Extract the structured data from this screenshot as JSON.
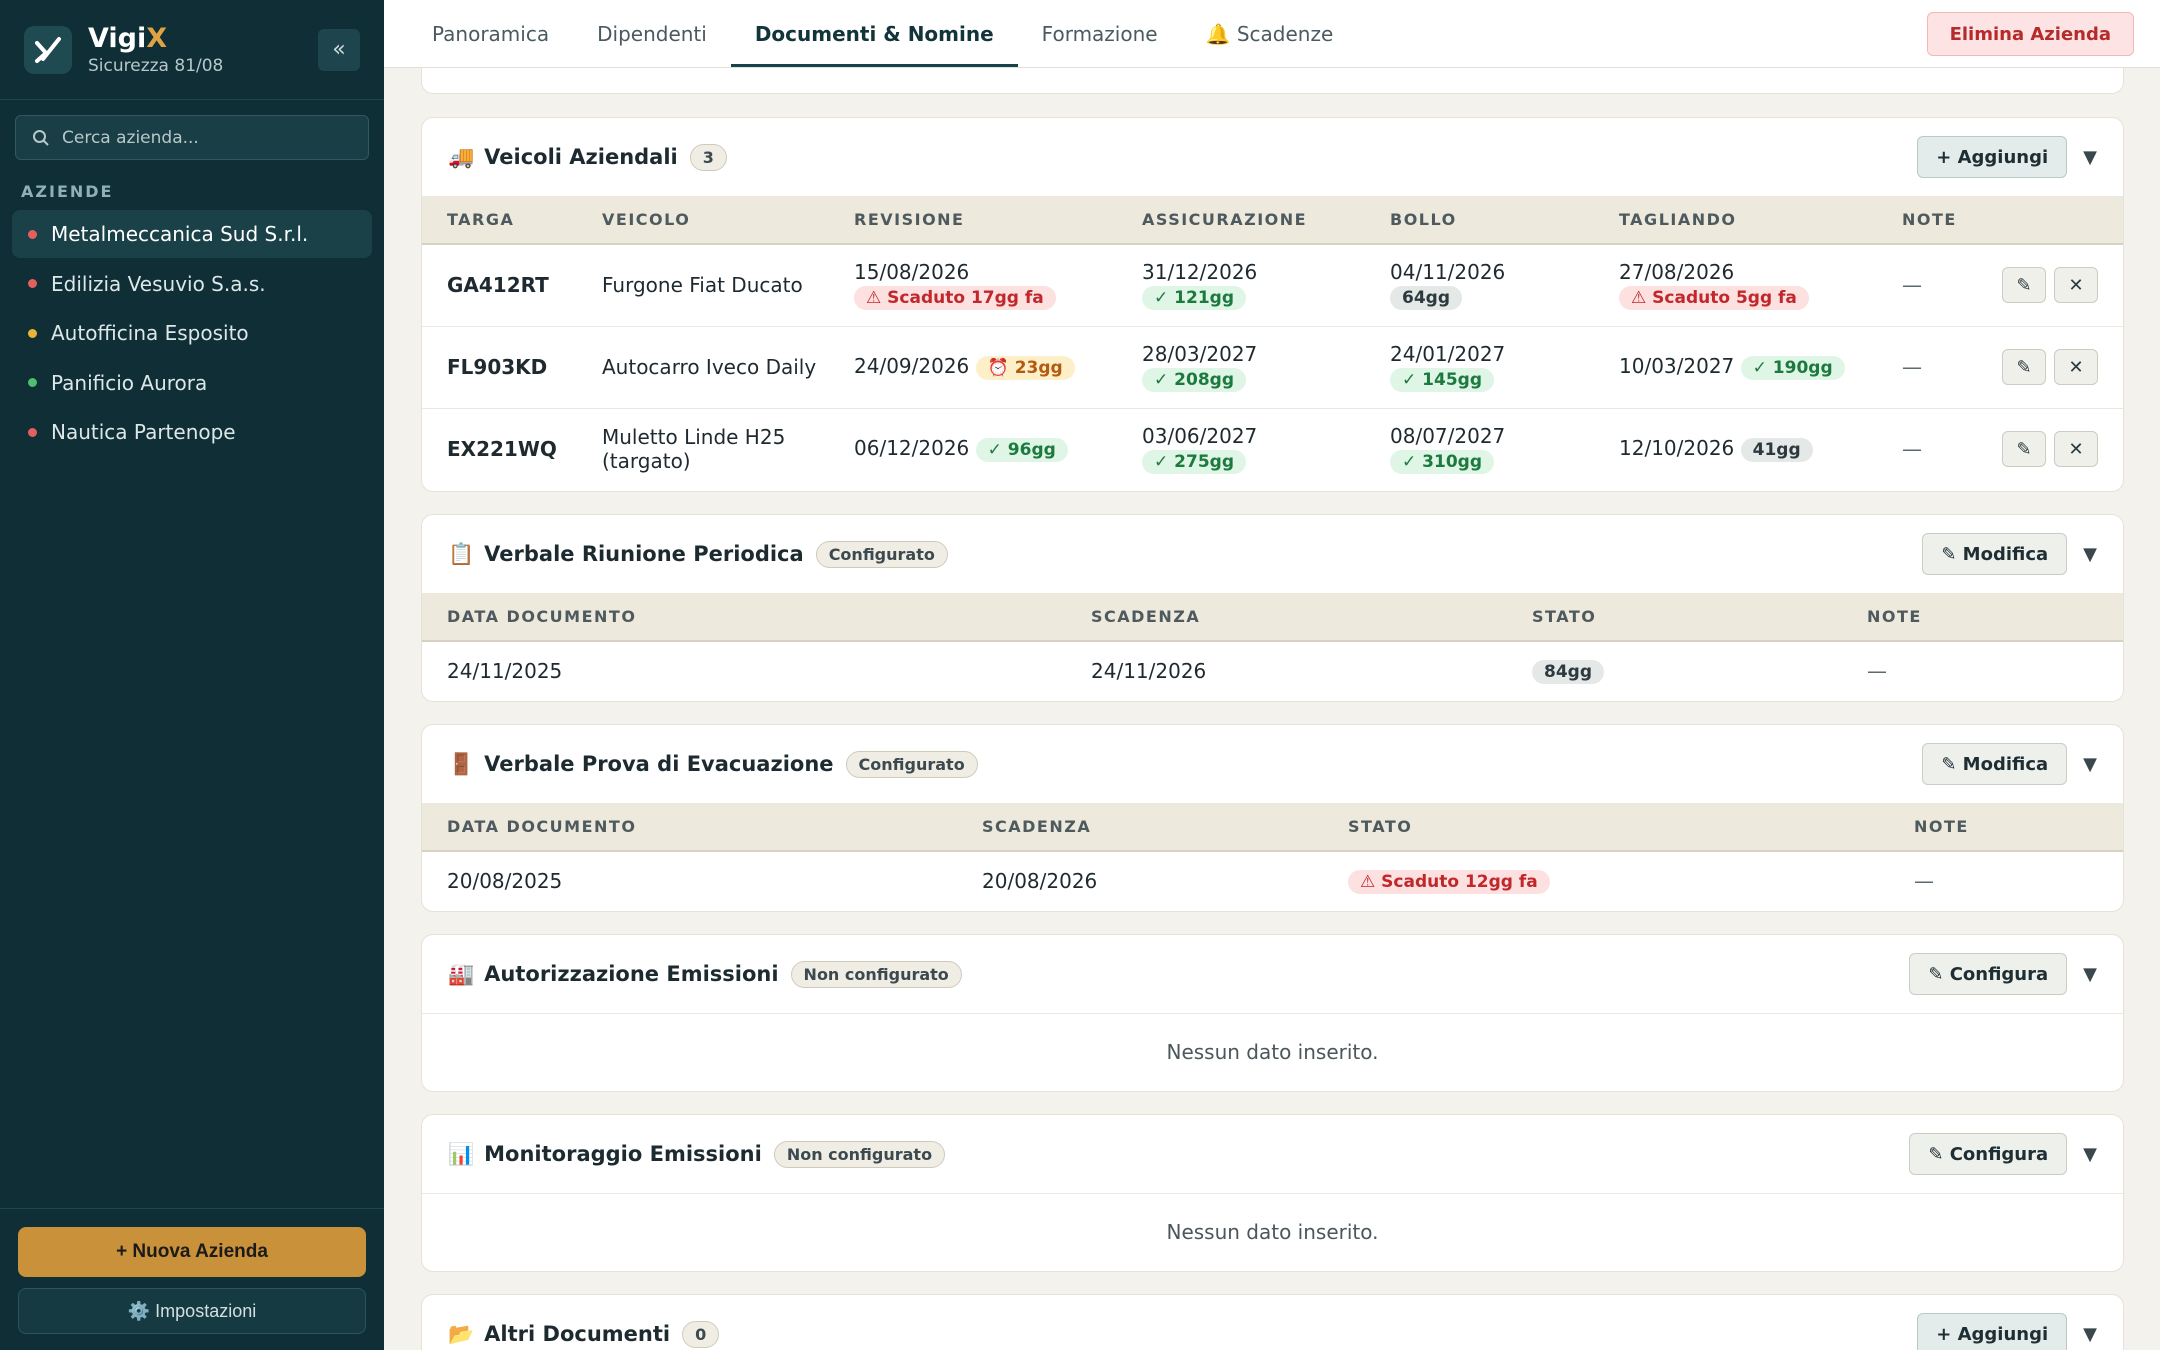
{
  "app": {
    "name": "Vigi",
    "name_accent": "X",
    "subtitle": "Sicurezza 81/08",
    "collapse_icon": "«"
  },
  "search": {
    "placeholder": "Cerca azienda..."
  },
  "sidebar": {
    "section_label": "AZIENDE",
    "companies": [
      {
        "label": "Metalmeccanica Sud S.r.l.",
        "status_color": "#e4605e",
        "active": true
      },
      {
        "label": "Edilizia Vesuvio S.a.s.",
        "status_color": "#e4605e"
      },
      {
        "label": "Autofficina Esposito",
        "status_color": "#e8b53a"
      },
      {
        "label": "Panificio Aurora",
        "status_color": "#4cc06e"
      },
      {
        "label": "Nautica Partenope",
        "status_color": "#e4605e"
      }
    ],
    "new_company_label": "+ Nuova Azienda",
    "settings_label": "⚙️ Impostazioni"
  },
  "topbar": {
    "tabs": [
      "Panoramica",
      "Dipendenti",
      "Documenti & Nomine",
      "Formazione",
      "🔔 Scadenze"
    ],
    "active_tab": 2,
    "delete_label": "Elimina Azienda"
  },
  "veicoli": {
    "icon": "🚚",
    "title": "Veicoli Aziendali",
    "count": "3",
    "add_label": "+ Aggiungi",
    "columns": [
      "TARGA",
      "VEICOLO",
      "REVISIONE",
      "ASSICURAZIONE",
      "BOLLO",
      "TAGLIANDO",
      "NOTE"
    ],
    "rows": [
      {
        "targa": "GA412RT",
        "veicolo": "Furgone Fiat Ducato",
        "revisione": {
          "date": "15/08/2026",
          "badge": "⚠ Scaduto 17gg fa",
          "tone": "red"
        },
        "assicurazione": {
          "date": "31/12/2026",
          "badge": "✓ 121gg",
          "tone": "green"
        },
        "bollo": {
          "date": "04/11/2026",
          "badge": "64gg",
          "tone": "gray"
        },
        "tagliando": {
          "date": "27/08/2026",
          "badge": "⚠ Scaduto 5gg fa",
          "tone": "red"
        },
        "note": "—"
      },
      {
        "targa": "FL903KD",
        "veicolo": "Autocarro Iveco Daily",
        "revisione": {
          "date": "24/09/2026",
          "badge": "⏰ 23gg",
          "tone": "amber"
        },
        "assicurazione": {
          "date": "28/03/2027",
          "badge": "✓ 208gg",
          "tone": "green"
        },
        "bollo": {
          "date": "24/01/2027",
          "badge": "✓ 145gg",
          "tone": "green"
        },
        "tagliando": {
          "date": "10/03/2027",
          "badge": "✓ 190gg",
          "tone": "green"
        },
        "note": "—"
      },
      {
        "targa": "EX221WQ",
        "veicolo": "Muletto Linde H25 (targato)",
        "revisione": {
          "date": "06/12/2026",
          "badge": "✓ 96gg",
          "tone": "green"
        },
        "assicurazione": {
          "date": "03/06/2027",
          "badge": "✓ 275gg",
          "tone": "green"
        },
        "bollo": {
          "date": "08/07/2027",
          "badge": "✓ 310gg",
          "tone": "green"
        },
        "tagliando": {
          "date": "12/10/2026",
          "badge": "41gg",
          "tone": "gray"
        },
        "note": "—"
      }
    ],
    "edit_icon": "✎",
    "delete_icon": "✕"
  },
  "riunione": {
    "icon": "📋",
    "title": "Verbale Riunione Periodica",
    "status": "Configurato",
    "action_label": "✎ Modifica",
    "columns": [
      "DATA DOCUMENTO",
      "SCADENZA",
      "STATO",
      "NOTE"
    ],
    "row": {
      "data": "24/11/2025",
      "scadenza": "24/11/2026",
      "stato": "84gg",
      "stato_tone": "gray",
      "note": "—"
    }
  },
  "evacuazione": {
    "icon": "🚪",
    "title": "Verbale Prova di Evacuazione",
    "status": "Configurato",
    "action_label": "✎ Modifica",
    "columns": [
      "DATA DOCUMENTO",
      "SCADENZA",
      "STATO",
      "NOTE"
    ],
    "row": {
      "data": "20/08/2025",
      "scadenza": "20/08/2026",
      "stato": "⚠ Scaduto 12gg fa",
      "stato_tone": "red",
      "note": "—"
    }
  },
  "autorizzazione": {
    "icon": "🏭",
    "title": "Autorizzazione Emissioni",
    "status": "Non configurato",
    "action_label": "✎ Configura",
    "empty": "Nessun dato inserito."
  },
  "monitoraggio": {
    "icon": "📊",
    "title": "Monitoraggio Emissioni",
    "status": "Non configurato",
    "action_label": "✎ Configura",
    "empty": "Nessun dato inserito."
  },
  "altri": {
    "icon": "📂",
    "title": "Altri Documenti",
    "count": "0",
    "add_label": "+ Aggiungi"
  },
  "chevron": "▼"
}
